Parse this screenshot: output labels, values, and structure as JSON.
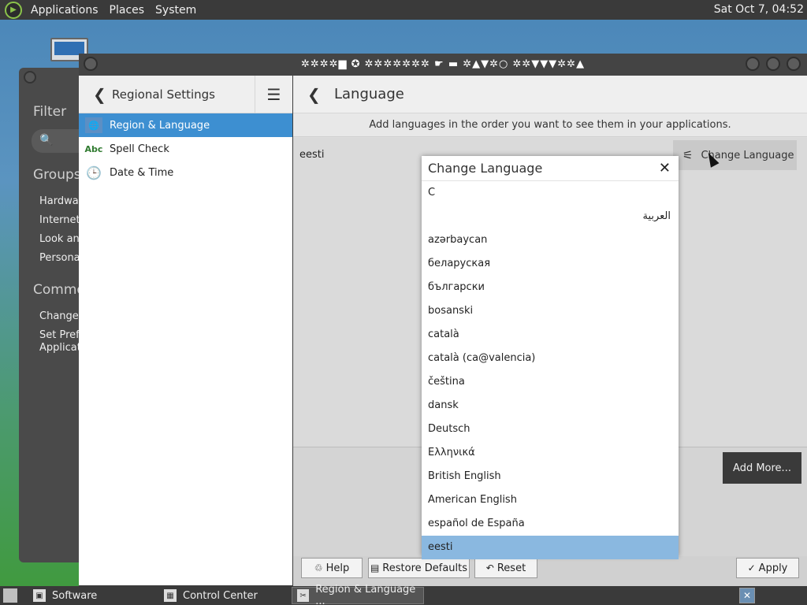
{
  "top_panel": {
    "menus": [
      "Applications",
      "Places",
      "System"
    ],
    "clock": "Sat Oct  7, 04:52"
  },
  "control_center_bg": {
    "filter_label": "Filter",
    "groups_label": "Groups",
    "group_items": [
      "Hardwar",
      "Internet a",
      "Look and",
      "Personal"
    ],
    "common_label": "Commo",
    "common_items": [
      "Change T",
      "Set Prefe",
      "Applicatio"
    ]
  },
  "window": {
    "title": "✲✲✲✲▆ ✪ ✲✲✲✲✲✲✲ ☛ ▬ ✲▲▼✲○ ✲✲▼▼▼✲✲▲"
  },
  "sidebar": {
    "title": "Regional Settings",
    "items": [
      {
        "label": "Region & Language",
        "icon": "globe-icon",
        "active": true
      },
      {
        "label": "Spell Check",
        "icon": "abc-icon",
        "active": false
      },
      {
        "label": "Date & Time",
        "icon": "clock-icon",
        "active": false
      }
    ]
  },
  "content": {
    "title": "Language",
    "hint": "Add languages in the order you want to see them in your applications.",
    "current_language": "eesti",
    "change_language_button": "Change Language",
    "add_more_button": "Add More..."
  },
  "buttons": {
    "help": "Help",
    "restore_defaults": "Restore Defaults",
    "reset": "Reset",
    "apply": "Apply"
  },
  "dialog": {
    "title": "Change Language",
    "languages": [
      "C",
      "العربية",
      "azərbaycan",
      "беларуская",
      "български",
      "bosanski",
      "català",
      "català (ca@valencia)",
      "čeština",
      "dansk",
      "Deutsch",
      "Ελληνικά",
      "British English",
      "American English",
      "español de España",
      "eesti"
    ],
    "selected": "eesti"
  },
  "taskbar": {
    "tasks": [
      {
        "label": "Software",
        "active": false
      },
      {
        "label": "Control Center",
        "active": false
      },
      {
        "label": "Region & Language ...",
        "active": true
      }
    ]
  },
  "colors": {
    "accent": "#3d8fd1",
    "selection": "#8ab8e0",
    "panel": "#3a3a3a"
  }
}
